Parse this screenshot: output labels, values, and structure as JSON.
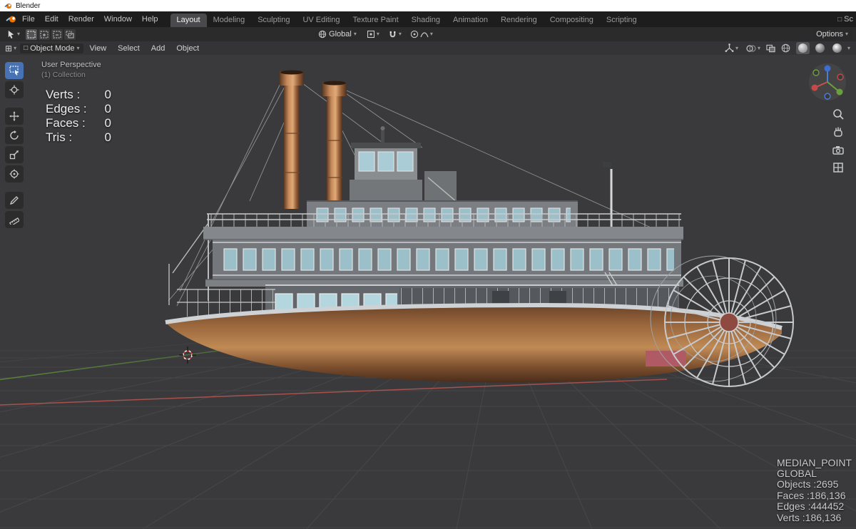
{
  "window": {
    "title": "Blender"
  },
  "menubar": {
    "menus": [
      "File",
      "Edit",
      "Render",
      "Window",
      "Help"
    ],
    "workspaces": [
      "Layout",
      "Modeling",
      "Sculpting",
      "UV Editing",
      "Texture Paint",
      "Shading",
      "Animation",
      "Rendering",
      "Compositing",
      "Scripting"
    ],
    "active_workspace": "Layout",
    "scene_truncated": "Sc"
  },
  "tool_settings": {
    "orientation_label": "Global",
    "options_label": "Options"
  },
  "viewport_header": {
    "mode_label": "Object Mode",
    "menus": [
      "View",
      "Select",
      "Add",
      "Object"
    ]
  },
  "viewport": {
    "view_label": "User Perspective",
    "collection_label": "(1) Collection",
    "stats": [
      {
        "label": "Verts :",
        "value": "0"
      },
      {
        "label": "Edges :",
        "value": "0"
      },
      {
        "label": "Faces :",
        "value": "0"
      },
      {
        "label": "Tris :",
        "value": "0"
      }
    ],
    "overlay_lines": [
      "MEDIAN_POINT",
      "GLOBAL",
      "Objects :2695",
      "Faces :186,136",
      "Edges :444452",
      "Verts :186,136"
    ]
  },
  "icons": {
    "chevron": "▾",
    "cube": "□",
    "editor": "⊞"
  },
  "colors": {
    "accent_blue": "#4772b3",
    "viewport_bg": "#3a3a3c",
    "copper": "#b5784a",
    "axis_red": "#a8514e",
    "axis_green": "#5d8a3c"
  }
}
